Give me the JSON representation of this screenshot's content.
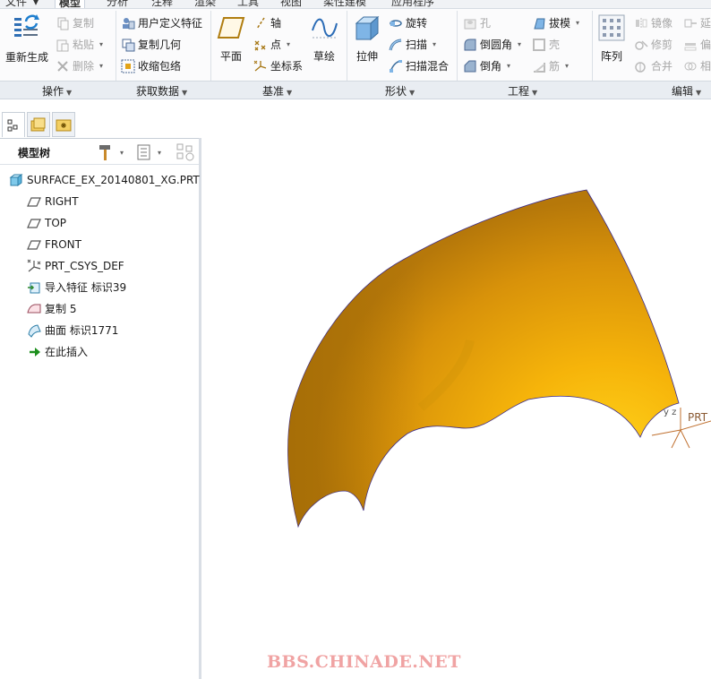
{
  "menu_tabs": [
    "文件",
    "模型",
    "分析",
    "注释",
    "渲染",
    "工具",
    "视图",
    "柔性建模",
    "应用程序"
  ],
  "ribbon": {
    "operations": {
      "regenerate": "重新生成",
      "copy": "复制",
      "paste": "粘贴",
      "delete": "删除",
      "label": "操作"
    },
    "get_data": {
      "udf": "用户定义特征",
      "copy_geom": "复制几何",
      "shrinkwrap": "收缩包络",
      "label": "获取数据"
    },
    "datum": {
      "plane": "平面",
      "axis": "轴",
      "point": "点",
      "csys": "坐标系",
      "sketch": "草绘",
      "label": "基准"
    },
    "shapes": {
      "extrude": "拉伸",
      "revolve": "旋转",
      "sweep": "扫描",
      "swept_blend": "扫描混合",
      "label": "形状"
    },
    "engineering": {
      "hole": "孔",
      "round": "倒圆角",
      "chamfer": "倒角",
      "draft": "拔模",
      "shell": "壳",
      "rib": "筋",
      "label": "工程"
    },
    "editing": {
      "pattern": "阵列",
      "mirror": "镜像",
      "trim": "修剪",
      "merge": "合并",
      "extend": "延伸",
      "offset": "偏移",
      "intersect": "相交",
      "label": "编辑"
    }
  },
  "model_tree": {
    "title": "模型树",
    "items": [
      {
        "label": "SURFACE_EX_20140801_XG.PRT",
        "icon": "part-icon"
      },
      {
        "label": "RIGHT",
        "icon": "datum-plane-icon"
      },
      {
        "label": "TOP",
        "icon": "datum-plane-icon"
      },
      {
        "label": "FRONT",
        "icon": "datum-plane-icon"
      },
      {
        "label": "PRT_CSYS_DEF",
        "icon": "csys-icon"
      },
      {
        "label": "导入特征 标识39",
        "icon": "import-feature-icon"
      },
      {
        "label": "复制 5",
        "icon": "copy-feature-icon"
      },
      {
        "label": "曲面 标识1771",
        "icon": "surface-icon"
      },
      {
        "label": "在此插入",
        "icon": "insert-here-arrow-icon"
      }
    ]
  },
  "viewport": {
    "csys_label": "PRT",
    "surface_color": "#E8A400",
    "edge_color": "#3A2A8C"
  },
  "watermark": "BBS.CHINADE.NET"
}
